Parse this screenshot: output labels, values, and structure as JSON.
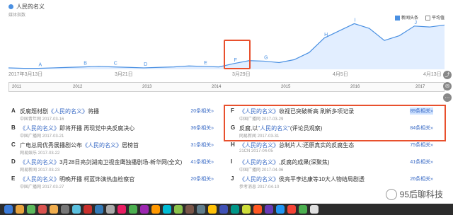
{
  "header": {
    "title": "人民的名义",
    "subtitle": "媒体指数",
    "options": [
      {
        "label": "新闻头条",
        "checked": true
      },
      {
        "label": "平均值",
        "checked": false
      }
    ]
  },
  "axis": {
    "dates": [
      "2017年3月13日",
      "3月21日",
      "3月29日",
      "4月5日",
      "4月13日"
    ],
    "timeline_years": [
      "2011",
      "2012",
      "2013",
      "2014",
      "2015",
      "2016",
      "2017"
    ]
  },
  "chart_data": {
    "type": "line",
    "series": [
      {
        "values": [
          3,
          2,
          2,
          3,
          4,
          5,
          6,
          5,
          4,
          3,
          4,
          5,
          7,
          6,
          5,
          12,
          18,
          17,
          14,
          20,
          35,
          65,
          80,
          95,
          85,
          60,
          70,
          90,
          88,
          92
        ]
      }
    ],
    "markers": [
      "A",
      "B",
      "C",
      "D",
      "E",
      "F",
      "G",
      "H",
      "I",
      "J"
    ],
    "grid": false
  },
  "news": {
    "left": [
      {
        "letter": "A",
        "pre": "反腐题材剧",
        "hl": "《人民的名义》",
        "post": "将播",
        "meta": "中国青年网 2017-03-16",
        "related": "20条相关»"
      },
      {
        "letter": "B",
        "pre": "",
        "hl": "《人民的名义》",
        "post": "即将开播 再现党中央反腐决心",
        "meta": "中国广播网 2017-03-21",
        "related": "36条相关»"
      },
      {
        "letter": "C",
        "pre": "广电总局优秀展播剧公布",
        "hl": "《人民的名义》",
        "post": "居榜首",
        "meta": "网易娱乐 2017-03-22",
        "related": "31条相关»"
      },
      {
        "letter": "D",
        "pre": "",
        "hl": "《人民的名义》",
        "post": "3月28日亮剑湖南卫视金鹰独播剧场-新华网(全文)",
        "meta": "网易新闻 2017-03-23",
        "related": "41条相关»"
      },
      {
        "letter": "E",
        "pre": "",
        "hl": "《人民的名义》",
        "post": "明晚开播 柯蓝饰演热血检察官",
        "meta": "中国广播网 2017-03-27",
        "related": "20条相关»"
      }
    ],
    "right": [
      {
        "letter": "F",
        "pre": "",
        "hl": "《人民的名义》",
        "post": "收视已突破新高 刷新多项记录",
        "meta": "中国广播网 2017-03-29",
        "related": "89条相关»",
        "highlight": true
      },
      {
        "letter": "G",
        "pre": "反腐,以",
        "hl": "\"人民的名义\"",
        "post": "(评论员观察)",
        "meta": "网易新闻 2017-03-31",
        "related": "84条相关»"
      },
      {
        "letter": "H",
        "pre": "",
        "hl": "《人民的名义》",
        "post": "总制片人:还原真实的反腐生态",
        "meta": "21CN 2017-04-05",
        "related": "75条相关»"
      },
      {
        "letter": "I",
        "pre": "",
        "hl": "《人民的名义》",
        "post": ",反腐的成果(深聚焦)",
        "meta": "中国广播网 2017-04-06",
        "related": "41条相关»"
      },
      {
        "letter": "J",
        "pre": "",
        "hl": "《人民的名义》",
        "post": "侯亮平李达康等10大人物结局剧透",
        "meta": "参考消息 2017-04-10",
        "related": "26条相关»"
      }
    ]
  },
  "watermark": {
    "label": "95后聊科技"
  },
  "colors": {
    "line": "#4a90e2",
    "fill": "#cfe2ff",
    "accent": "#e8502d"
  }
}
